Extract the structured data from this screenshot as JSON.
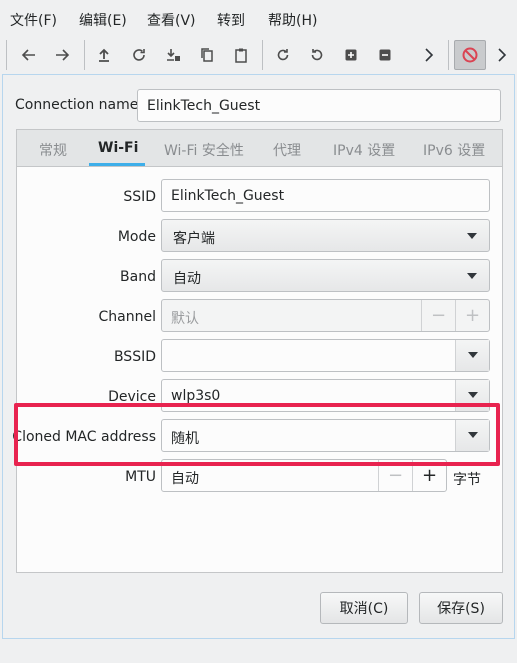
{
  "menubar": {
    "items": [
      "文件(F)",
      "编辑(E)",
      "查看(V)",
      "转到",
      "帮助(H)"
    ]
  },
  "toolbar": {
    "icons": [
      "arrow-left-icon",
      "arrow-right-icon",
      "upload-icon",
      "refresh-icon",
      "download-lock-icon",
      "copy-icon",
      "clipboard-icon",
      "rotate-cw-icon",
      "rotate-ccw-icon",
      "add-square-icon",
      "remove-square-icon",
      "chevron-right-icon",
      "no-entry-icon",
      "chevron-more-icon"
    ]
  },
  "dialog": {
    "connection_name_label": "Connection name",
    "connection_name_value": "ElinkTech_Guest",
    "tabs": [
      "常规",
      "Wi-Fi",
      "Wi-Fi 安全性",
      "代理",
      "IPv4 设置",
      "IPv6 设置"
    ],
    "active_tab": "Wi-Fi",
    "fields": {
      "ssid_label": "SSID",
      "ssid_value": "ElinkTech_Guest",
      "mode_label": "Mode",
      "mode_value": "客户端",
      "band_label": "Band",
      "band_value": "自动",
      "channel_label": "Channel",
      "channel_value": "默认",
      "bssid_label": "BSSID",
      "bssid_value": "",
      "device_label": "Device",
      "device_value": "wlp3s0",
      "cloned_mac_label": "Cloned MAC address",
      "cloned_mac_value": "随机",
      "mtu_label": "MTU",
      "mtu_value": "自动",
      "mtu_unit": "字节",
      "minus": "−",
      "plus": "+"
    },
    "buttons": {
      "cancel": "取消(C)",
      "save": "保存(S)"
    }
  },
  "colors": {
    "highlight": "#e8234f",
    "accent": "#3daee9"
  }
}
